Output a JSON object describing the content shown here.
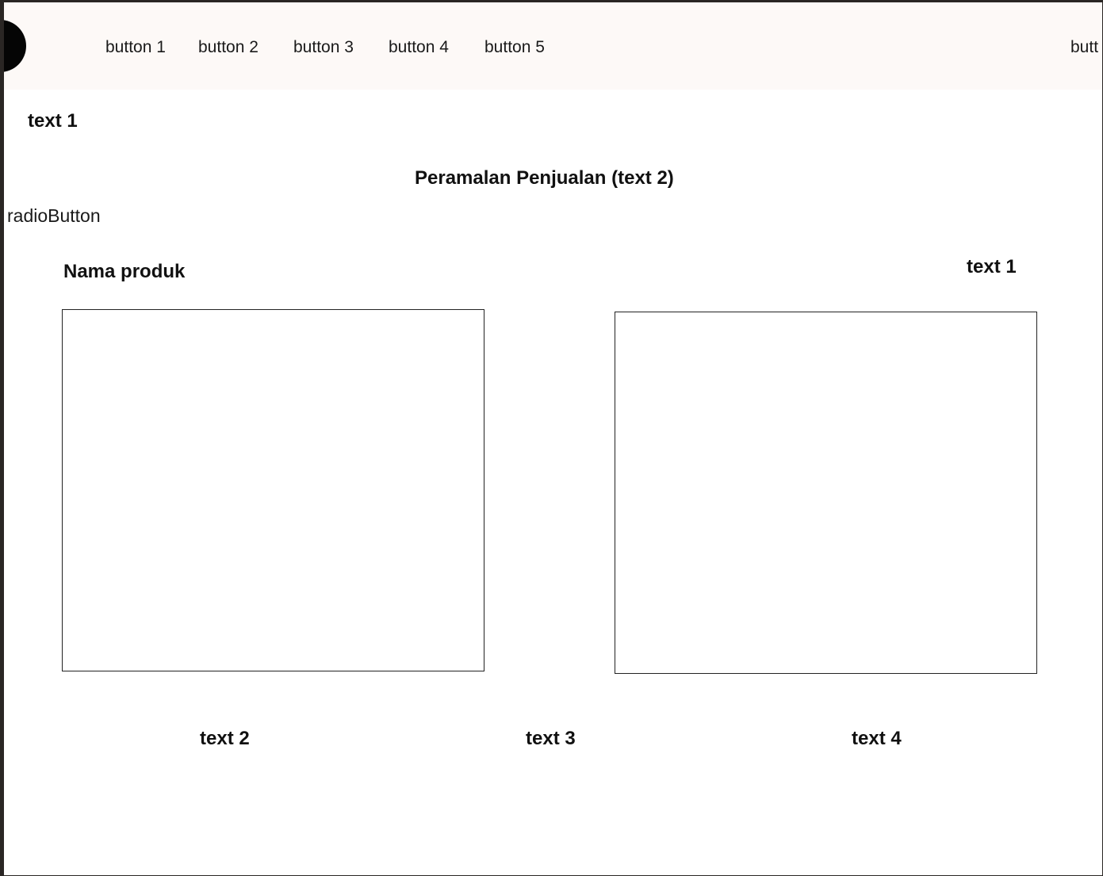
{
  "navbar": {
    "buttons": [
      "button 1",
      "button 2",
      "button 3",
      "button 4",
      "button 5"
    ],
    "right_button_partial": "butt"
  },
  "content": {
    "text1_top": "text 1",
    "title": "Peramalan Penjualan (text 2)",
    "radio_label": "radioButton",
    "product_label": "Nama produk",
    "text1_right": "text 1",
    "bottom_texts": [
      "text 2",
      "text 3",
      "text 4"
    ]
  }
}
